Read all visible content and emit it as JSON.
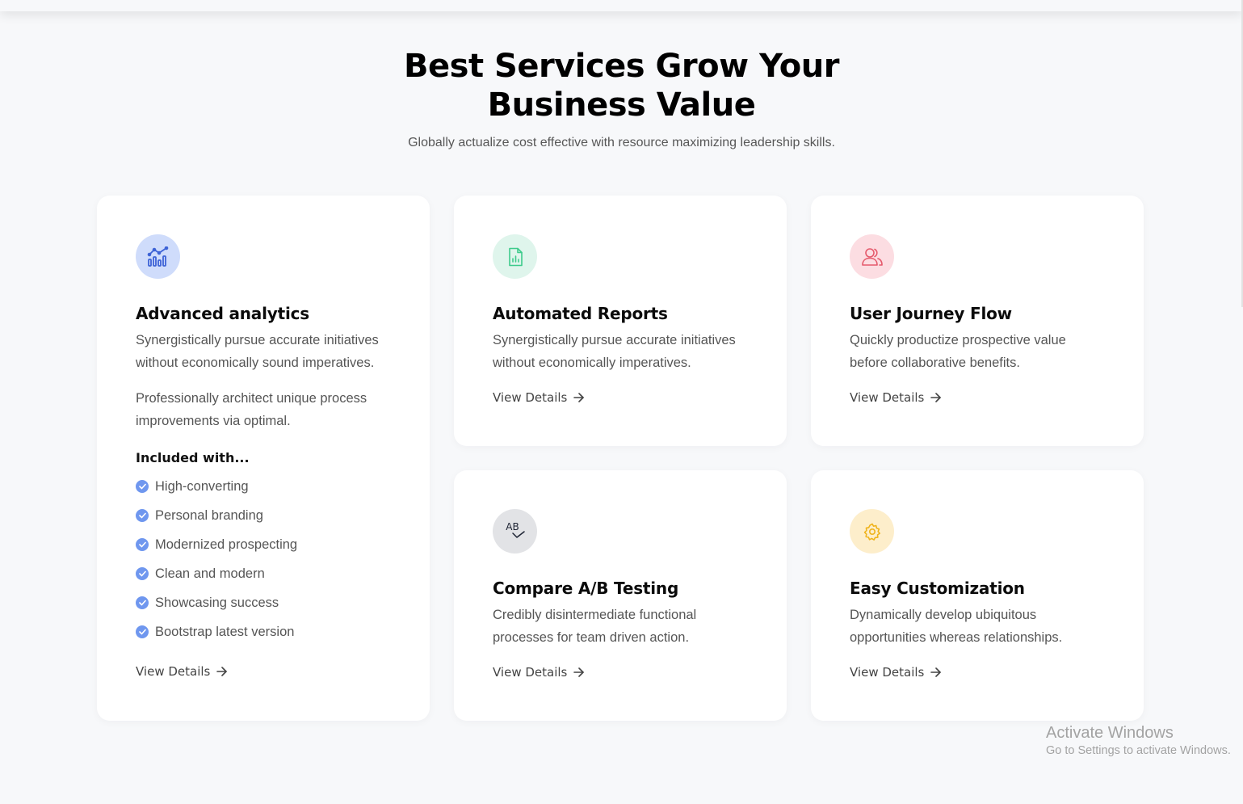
{
  "section": {
    "title_line1": "Best Services Grow Your",
    "title_line2": "Business Value",
    "subtitle": "Globally actualize cost effective with resource maximizing leadership skills."
  },
  "cards": [
    {
      "icon": "analytics-chart-icon",
      "icon_bg": "#cfdcfb",
      "icon_color": "#3d63d6",
      "title": "Advanced analytics",
      "text": "Synergistically pursue accurate initiatives without economically sound imperatives.",
      "text2": "Professionally architect unique process improvements via optimal.",
      "included_label": "Included with...",
      "features": [
        "High-converting",
        "Personal branding",
        "Modernized prospecting",
        "Clean and modern",
        "Showcasing success",
        "Bootstrap latest version"
      ],
      "link": "View Details"
    },
    {
      "icon": "report-document-icon",
      "icon_bg": "#dff5ec",
      "icon_color": "#3ecb8c",
      "title": "Automated Reports",
      "text": "Synergistically pursue accurate initiatives without economically imperatives.",
      "link": "View Details"
    },
    {
      "icon": "users-icon",
      "icon_bg": "#fcdde2",
      "icon_color": "#e55a6c",
      "title": "User Journey Flow",
      "text": "Quickly productize prospective value before collaborative benefits.",
      "link": "View Details"
    },
    {
      "icon": "ab-testing-icon",
      "icon_bg": "#e2e3e6",
      "icon_color": "#1d2333",
      "icon_text": "AB",
      "title": "Compare A/B Testing",
      "text": "Credibly disintermediate functional processes for team driven action.",
      "link": "View Details"
    },
    {
      "icon": "gear-icon",
      "icon_bg": "#fdeecb",
      "icon_color": "#efb31c",
      "title": "Easy Customization",
      "text": "Dynamically develop ubiquitous opportunities whereas relationships.",
      "link": "View Details"
    }
  ],
  "watermark": {
    "line1": "Activate Windows",
    "line2": "Go to Settings to activate Windows."
  }
}
